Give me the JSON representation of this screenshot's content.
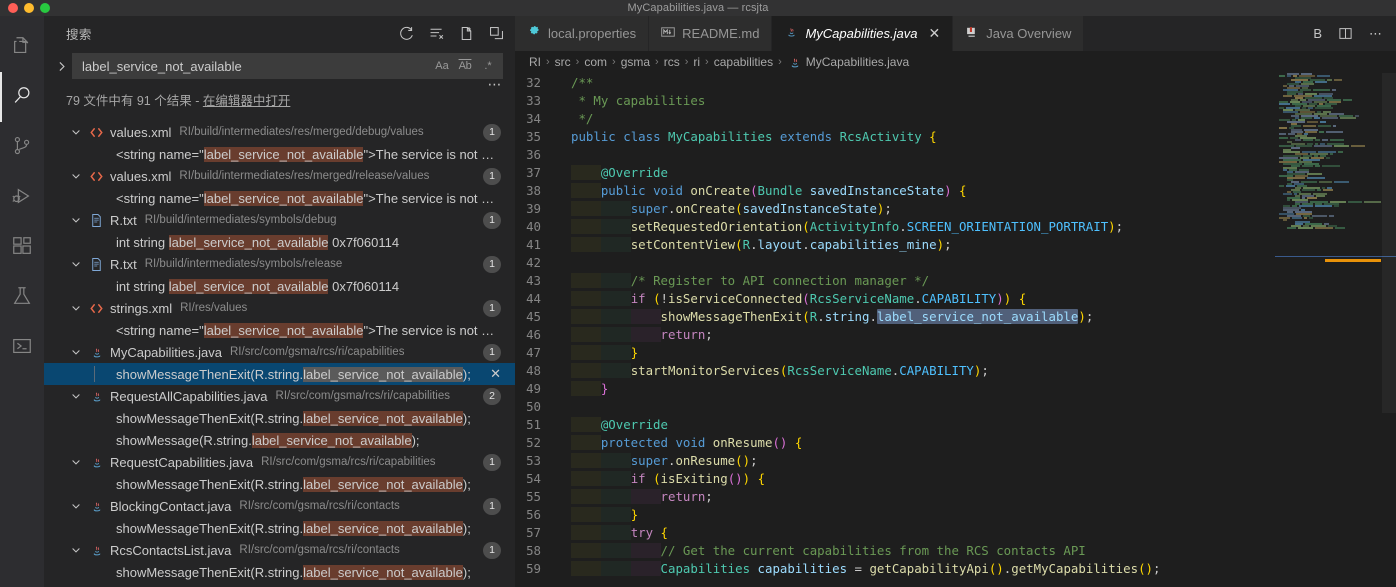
{
  "window": {
    "title": "MyCapabilities.java — rcsjta",
    "traffic_lights": [
      "close",
      "minimize",
      "zoom"
    ]
  },
  "activity_bar": {
    "items": [
      {
        "name": "explorer",
        "icon": "files-icon",
        "active": false
      },
      {
        "name": "search",
        "icon": "search-icon",
        "active": true
      },
      {
        "name": "source-control",
        "icon": "source-control-icon",
        "active": false
      },
      {
        "name": "run-and-debug",
        "icon": "debug-icon",
        "active": false
      },
      {
        "name": "extensions",
        "icon": "extensions-icon",
        "active": false
      },
      {
        "name": "testing",
        "icon": "beaker-icon",
        "active": false
      },
      {
        "name": "terminal",
        "icon": "terminal-icon",
        "active": false
      }
    ]
  },
  "sidebar": {
    "title": "搜索",
    "actions": [
      {
        "name": "refresh",
        "icon": "refresh-icon"
      },
      {
        "name": "clear-search-results",
        "icon": "clear-all-icon"
      },
      {
        "name": "open-new-search-editor",
        "icon": "new-editor-icon"
      },
      {
        "name": "collapse-all",
        "icon": "collapse-all-icon"
      }
    ],
    "search": {
      "value": "label_service_not_available",
      "placeholder": "搜索",
      "expanded": false,
      "toggles": [
        {
          "name": "match-case",
          "label": "Aa"
        },
        {
          "name": "match-whole-word",
          "label": "Ab"
        },
        {
          "name": "use-regex",
          "label": ".*"
        }
      ]
    },
    "summary": {
      "prefix": "79 文件中有 91 个结果 - ",
      "link": "在编辑器中打开"
    },
    "more_actions": "⋯",
    "results": [
      {
        "file": "values.xml",
        "path": "RI/build/intermediates/res/merged/debug/values",
        "icon": "xml-file-icon",
        "count": "1",
        "matches": [
          {
            "pre": "<string name=\"",
            "hit": "label_service_not_available",
            "post": "\">The service is not availa…",
            "selected": false
          }
        ]
      },
      {
        "file": "values.xml",
        "path": "RI/build/intermediates/res/merged/release/values",
        "icon": "xml-file-icon",
        "count": "1",
        "matches": [
          {
            "pre": "<string name=\"",
            "hit": "label_service_not_available",
            "post": "\">The service is not availa…",
            "selected": false
          }
        ]
      },
      {
        "file": "R.txt",
        "path": "RI/build/intermediates/symbols/debug",
        "icon": "text-file-icon",
        "count": "1",
        "matches": [
          {
            "pre": "int string ",
            "hit": "label_service_not_available",
            "post": " 0x7f060114",
            "selected": false
          }
        ]
      },
      {
        "file": "R.txt",
        "path": "RI/build/intermediates/symbols/release",
        "icon": "text-file-icon",
        "count": "1",
        "matches": [
          {
            "pre": "int string ",
            "hit": "label_service_not_available",
            "post": " 0x7f060114",
            "selected": false
          }
        ]
      },
      {
        "file": "strings.xml",
        "path": "RI/res/values",
        "icon": "xml-file-icon",
        "count": "1",
        "matches": [
          {
            "pre": "<string name=\"",
            "hit": "label_service_not_available",
            "post": "\">The service is not availa…",
            "selected": false
          }
        ]
      },
      {
        "file": "MyCapabilities.java",
        "path": "RI/src/com/gsma/rcs/ri/capabilities",
        "icon": "java-file-icon",
        "count": "1",
        "matches": [
          {
            "pre": "showMessageThenExit(R.string.",
            "hit": "label_service_not_available",
            "post": ");",
            "selected": true,
            "dismiss": "✕"
          }
        ]
      },
      {
        "file": "RequestAllCapabilities.java",
        "path": "RI/src/com/gsma/rcs/ri/capabilities",
        "icon": "java-file-icon",
        "count": "2",
        "matches": [
          {
            "pre": "showMessageThenExit(R.string.",
            "hit": "label_service_not_available",
            "post": ");",
            "selected": false
          },
          {
            "pre": "showMessage(R.string.",
            "hit": "label_service_not_available",
            "post": ");",
            "selected": false
          }
        ]
      },
      {
        "file": "RequestCapabilities.java",
        "path": "RI/src/com/gsma/rcs/ri/capabilities",
        "icon": "java-file-icon",
        "count": "1",
        "matches": [
          {
            "pre": "showMessageThenExit(R.string.",
            "hit": "label_service_not_available",
            "post": ");",
            "selected": false
          }
        ]
      },
      {
        "file": "BlockingContact.java",
        "path": "RI/src/com/gsma/rcs/ri/contacts",
        "icon": "java-file-icon",
        "count": "1",
        "matches": [
          {
            "pre": "showMessageThenExit(R.string.",
            "hit": "label_service_not_available",
            "post": ");",
            "selected": false
          }
        ]
      },
      {
        "file": "RcsContactsList.java",
        "path": "RI/src/com/gsma/rcs/ri/contacts",
        "icon": "java-file-icon",
        "count": "1",
        "matches": [
          {
            "pre": "showMessageThenExit(R.string.",
            "hit": "label_service_not_available",
            "post": ");",
            "selected": false
          }
        ]
      }
    ]
  },
  "editor": {
    "tabs": [
      {
        "label": "local.properties",
        "icon": "gear-icon",
        "active": false,
        "closable": false
      },
      {
        "label": "README.md",
        "icon": "markdown-icon",
        "active": false,
        "closable": false
      },
      {
        "label": "MyCapabilities.java",
        "icon": "java-file-icon",
        "active": true,
        "closable": true,
        "close": "✕"
      },
      {
        "label": "Java Overview",
        "icon": "java-overview-icon",
        "active": false,
        "closable": false
      }
    ],
    "toolbar": [
      {
        "name": "bookmark-b-button",
        "label": "B"
      },
      {
        "name": "split-editor-button",
        "label": "split"
      },
      {
        "name": "more-actions-button",
        "label": "⋯"
      }
    ],
    "breadcrumb": [
      "RI",
      "src",
      "com",
      "gsma",
      "rcs",
      "ri",
      "capabilities",
      "MyCapabilities.java"
    ],
    "breadcrumb_separator": "›",
    "first_line_number": 32,
    "code_lines": [
      {
        "n": 32,
        "indent": 0,
        "tokens": [
          {
            "t": "/**",
            "c": "c-cmt"
          }
        ]
      },
      {
        "n": 33,
        "indent": 0,
        "tokens": [
          {
            "t": " * My capabilities",
            "c": "c-cmt"
          }
        ]
      },
      {
        "n": 34,
        "indent": 0,
        "tokens": [
          {
            "t": " */",
            "c": "c-cmt"
          }
        ]
      },
      {
        "n": 35,
        "indent": 0,
        "tokens": [
          {
            "t": "public",
            "c": "c-kw"
          },
          {
            "t": " ",
            "c": "c-pun"
          },
          {
            "t": "class",
            "c": "c-kw"
          },
          {
            "t": " ",
            "c": "c-pun"
          },
          {
            "t": "MyCapabilities",
            "c": "c-cls"
          },
          {
            "t": " ",
            "c": "c-pun"
          },
          {
            "t": "extends",
            "c": "c-kw"
          },
          {
            "t": " ",
            "c": "c-pun"
          },
          {
            "t": "RcsActivity",
            "c": "c-cls"
          },
          {
            "t": " ",
            "c": "c-pun"
          },
          {
            "t": "{",
            "c": "c-br1"
          }
        ]
      },
      {
        "n": 36,
        "indent": 0,
        "tokens": []
      },
      {
        "n": 37,
        "indent": 1,
        "tokens": [
          {
            "t": "@Override",
            "c": "c-ann"
          }
        ]
      },
      {
        "n": 38,
        "indent": 1,
        "tokens": [
          {
            "t": "public",
            "c": "c-kw"
          },
          {
            "t": " ",
            "c": "c-pun"
          },
          {
            "t": "void",
            "c": "c-kw"
          },
          {
            "t": " ",
            "c": "c-pun"
          },
          {
            "t": "onCreate",
            "c": "c-fn"
          },
          {
            "t": "(",
            "c": "c-br2"
          },
          {
            "t": "Bundle",
            "c": "c-cls"
          },
          {
            "t": " ",
            "c": "c-pun"
          },
          {
            "t": "savedInstanceState",
            "c": "c-var"
          },
          {
            "t": ")",
            "c": "c-br2"
          },
          {
            "t": " ",
            "c": "c-pun"
          },
          {
            "t": "{",
            "c": "c-br1"
          }
        ]
      },
      {
        "n": 39,
        "indent": 2,
        "tokens": [
          {
            "t": "super",
            "c": "c-kw"
          },
          {
            "t": ".",
            "c": "c-pun"
          },
          {
            "t": "onCreate",
            "c": "c-fn"
          },
          {
            "t": "(",
            "c": "c-br1"
          },
          {
            "t": "savedInstanceState",
            "c": "c-var"
          },
          {
            "t": ")",
            "c": "c-br1"
          },
          {
            "t": ";",
            "c": "c-pun"
          }
        ]
      },
      {
        "n": 40,
        "indent": 2,
        "tokens": [
          {
            "t": "setRequestedOrientation",
            "c": "c-fn"
          },
          {
            "t": "(",
            "c": "c-br1"
          },
          {
            "t": "ActivityInfo",
            "c": "c-cls"
          },
          {
            "t": ".",
            "c": "c-pun"
          },
          {
            "t": "SCREEN_ORIENTATION_PORTRAIT",
            "c": "c-cst"
          },
          {
            "t": ")",
            "c": "c-br1"
          },
          {
            "t": ";",
            "c": "c-pun"
          }
        ]
      },
      {
        "n": 41,
        "indent": 2,
        "tokens": [
          {
            "t": "setContentView",
            "c": "c-fn"
          },
          {
            "t": "(",
            "c": "c-br1"
          },
          {
            "t": "R",
            "c": "c-cls"
          },
          {
            "t": ".",
            "c": "c-pun"
          },
          {
            "t": "layout",
            "c": "c-var"
          },
          {
            "t": ".",
            "c": "c-pun"
          },
          {
            "t": "capabilities_mine",
            "c": "c-var"
          },
          {
            "t": ")",
            "c": "c-br1"
          },
          {
            "t": ";",
            "c": "c-pun"
          }
        ]
      },
      {
        "n": 42,
        "indent": 0,
        "tokens": []
      },
      {
        "n": 43,
        "indent": 2,
        "tokens": [
          {
            "t": "/* Register to API connection manager */",
            "c": "c-cmt"
          }
        ]
      },
      {
        "n": 44,
        "indent": 2,
        "tokens": [
          {
            "t": "if",
            "c": "c-ctl"
          },
          {
            "t": " ",
            "c": "c-pun"
          },
          {
            "t": "(",
            "c": "c-br1"
          },
          {
            "t": "!",
            "c": "c-pun"
          },
          {
            "t": "isServiceConnected",
            "c": "c-fn"
          },
          {
            "t": "(",
            "c": "c-br2"
          },
          {
            "t": "RcsServiceName",
            "c": "c-cls"
          },
          {
            "t": ".",
            "c": "c-pun"
          },
          {
            "t": "CAPABILITY",
            "c": "c-cst"
          },
          {
            "t": ")",
            "c": "c-br2"
          },
          {
            "t": ")",
            "c": "c-br1"
          },
          {
            "t": " ",
            "c": "c-pun"
          },
          {
            "t": "{",
            "c": "c-br1"
          }
        ]
      },
      {
        "n": 45,
        "indent": 3,
        "match": true,
        "tokens": [
          {
            "t": "showMessageThenExit",
            "c": "c-fn"
          },
          {
            "t": "(",
            "c": "c-br1"
          },
          {
            "t": "R",
            "c": "c-cls"
          },
          {
            "t": ".",
            "c": "c-pun"
          },
          {
            "t": "string",
            "c": "c-var"
          },
          {
            "t": ".",
            "c": "c-pun"
          },
          {
            "t": "label_service_not_available",
            "c": "c-var",
            "sel": true
          },
          {
            "t": ")",
            "c": "c-br1"
          },
          {
            "t": ";",
            "c": "c-pun"
          }
        ]
      },
      {
        "n": 46,
        "indent": 3,
        "tokens": [
          {
            "t": "return",
            "c": "c-ctl"
          },
          {
            "t": ";",
            "c": "c-pun"
          }
        ]
      },
      {
        "n": 47,
        "indent": 2,
        "tokens": [
          {
            "t": "}",
            "c": "c-br1"
          }
        ]
      },
      {
        "n": 48,
        "indent": 2,
        "tokens": [
          {
            "t": "startMonitorServices",
            "c": "c-fn"
          },
          {
            "t": "(",
            "c": "c-br1"
          },
          {
            "t": "RcsServiceName",
            "c": "c-cls"
          },
          {
            "t": ".",
            "c": "c-pun"
          },
          {
            "t": "CAPABILITY",
            "c": "c-cst"
          },
          {
            "t": ")",
            "c": "c-br1"
          },
          {
            "t": ";",
            "c": "c-pun"
          }
        ]
      },
      {
        "n": 49,
        "indent": 1,
        "tokens": [
          {
            "t": "}",
            "c": "c-br2"
          }
        ]
      },
      {
        "n": 50,
        "indent": 0,
        "tokens": []
      },
      {
        "n": 51,
        "indent": 1,
        "tokens": [
          {
            "t": "@Override",
            "c": "c-ann"
          }
        ]
      },
      {
        "n": 52,
        "indent": 1,
        "tokens": [
          {
            "t": "protected",
            "c": "c-kw"
          },
          {
            "t": " ",
            "c": "c-pun"
          },
          {
            "t": "void",
            "c": "c-kw"
          },
          {
            "t": " ",
            "c": "c-pun"
          },
          {
            "t": "onResume",
            "c": "c-fn"
          },
          {
            "t": "(",
            "c": "c-br2"
          },
          {
            "t": ")",
            "c": "c-br2"
          },
          {
            "t": " ",
            "c": "c-pun"
          },
          {
            "t": "{",
            "c": "c-br1"
          }
        ]
      },
      {
        "n": 53,
        "indent": 2,
        "tokens": [
          {
            "t": "super",
            "c": "c-kw"
          },
          {
            "t": ".",
            "c": "c-pun"
          },
          {
            "t": "onResume",
            "c": "c-fn"
          },
          {
            "t": "(",
            "c": "c-br1"
          },
          {
            "t": ")",
            "c": "c-br1"
          },
          {
            "t": ";",
            "c": "c-pun"
          }
        ]
      },
      {
        "n": 54,
        "indent": 2,
        "tokens": [
          {
            "t": "if",
            "c": "c-ctl"
          },
          {
            "t": " ",
            "c": "c-pun"
          },
          {
            "t": "(",
            "c": "c-br1"
          },
          {
            "t": "isExiting",
            "c": "c-fn"
          },
          {
            "t": "(",
            "c": "c-br2"
          },
          {
            "t": ")",
            "c": "c-br2"
          },
          {
            "t": ")",
            "c": "c-br1"
          },
          {
            "t": " ",
            "c": "c-pun"
          },
          {
            "t": "{",
            "c": "c-br1"
          }
        ]
      },
      {
        "n": 55,
        "indent": 3,
        "tokens": [
          {
            "t": "return",
            "c": "c-ctl"
          },
          {
            "t": ";",
            "c": "c-pun"
          }
        ]
      },
      {
        "n": 56,
        "indent": 2,
        "tokens": [
          {
            "t": "}",
            "c": "c-br1"
          }
        ]
      },
      {
        "n": 57,
        "indent": 2,
        "tokens": [
          {
            "t": "try",
            "c": "c-ctl"
          },
          {
            "t": " ",
            "c": "c-pun"
          },
          {
            "t": "{",
            "c": "c-br1"
          }
        ]
      },
      {
        "n": 58,
        "indent": 3,
        "tokens": [
          {
            "t": "// Get the current capabilities from the RCS contacts API",
            "c": "c-cmt"
          }
        ]
      },
      {
        "n": 59,
        "indent": 3,
        "tokens": [
          {
            "t": "Capabilities",
            "c": "c-cls"
          },
          {
            "t": " ",
            "c": "c-pun"
          },
          {
            "t": "capabilities",
            "c": "c-var"
          },
          {
            "t": " ",
            "c": "c-pun"
          },
          {
            "t": "=",
            "c": "c-pun"
          },
          {
            "t": " ",
            "c": "c-pun"
          },
          {
            "t": "getCapabilityApi",
            "c": "c-fn"
          },
          {
            "t": "(",
            "c": "c-br1"
          },
          {
            "t": ")",
            "c": "c-br1"
          },
          {
            "t": ".",
            "c": "c-pun"
          },
          {
            "t": "getMyCapabilities",
            "c": "c-fn"
          },
          {
            "t": "(",
            "c": "c-br1"
          },
          {
            "t": ")",
            "c": "c-br1"
          },
          {
            "t": ";",
            "c": "c-pun"
          }
        ]
      }
    ]
  },
  "colors": {
    "accent_selection": "#094771",
    "match_highlight": "#693d2e",
    "minimap_marker": "#e8920a",
    "editor_bg": "#1e1e1e",
    "sidebar_bg": "#252526",
    "activitybar_bg": "#2d2d30"
  }
}
